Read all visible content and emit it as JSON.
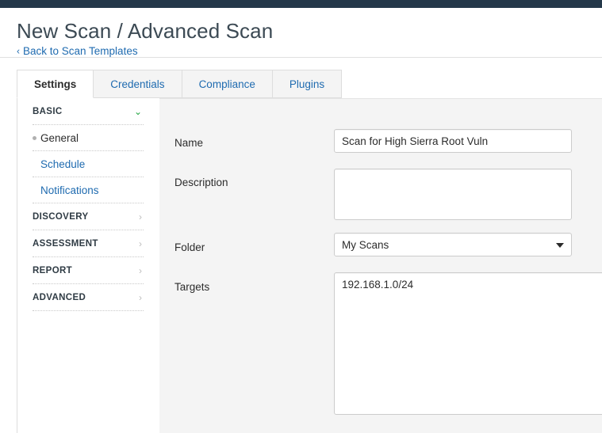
{
  "window": {
    "topbar_color": "#24384a"
  },
  "header": {
    "title": "New Scan / Advanced Scan",
    "back_link": "Back to Scan Templates",
    "back_chevron": "‹",
    "link_color": "#1f6bb0"
  },
  "tabs": [
    {
      "label": "Settings",
      "active": true
    },
    {
      "label": "Credentials",
      "active": false
    },
    {
      "label": "Compliance",
      "active": false
    },
    {
      "label": "Plugins",
      "active": false
    }
  ],
  "sidebar": {
    "groups": [
      {
        "label": "BASIC",
        "expanded": true,
        "chevron": "⌄",
        "items": [
          {
            "label": "General",
            "current": true
          },
          {
            "label": "Schedule",
            "current": false
          },
          {
            "label": "Notifications",
            "current": false
          }
        ]
      },
      {
        "label": "DISCOVERY",
        "expanded": false,
        "chevron": "›",
        "items": []
      },
      {
        "label": "ASSESSMENT",
        "expanded": false,
        "chevron": "›",
        "items": []
      },
      {
        "label": "REPORT",
        "expanded": false,
        "chevron": "›",
        "items": []
      },
      {
        "label": "ADVANCED",
        "expanded": false,
        "chevron": "›",
        "items": []
      }
    ]
  },
  "form": {
    "name": {
      "label": "Name",
      "value": "Scan for High Sierra Root Vuln",
      "placeholder": ""
    },
    "description": {
      "label": "Description",
      "value": "",
      "placeholder": ""
    },
    "folder": {
      "label": "Folder",
      "value": "My Scans",
      "options": [
        "My Scans"
      ]
    },
    "targets": {
      "label": "Targets",
      "value": "192.168.1.0/24",
      "placeholder": ""
    }
  }
}
